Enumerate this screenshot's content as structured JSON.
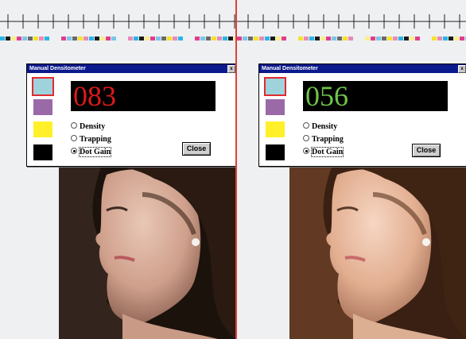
{
  "colors": {
    "swatch_cyan": "#9fd3dc",
    "swatch_magenta": "#9a6aa8",
    "swatch_yellow": "#fff02a",
    "swatch_black": "#000000",
    "readout_left_digits": "#dd1a1a",
    "readout_right_digits": "#6fc34a",
    "divider": "#e0403a"
  },
  "left_dialog": {
    "title": "Manual Densitometer",
    "close_x": "x",
    "readout": "083",
    "options": [
      "Density",
      "Trapping",
      "Dot Gain"
    ],
    "selected_option": "Dot Gain",
    "selected_swatch": "cyan",
    "close_label": "Close"
  },
  "right_dialog": {
    "title": "Manual Densitometer",
    "close_x": "x",
    "readout": "056",
    "options": [
      "Density",
      "Trapping",
      "Dot Gain"
    ],
    "selected_option": "Dot Gain",
    "selected_swatch": "cyan",
    "close_label": "Close"
  }
}
